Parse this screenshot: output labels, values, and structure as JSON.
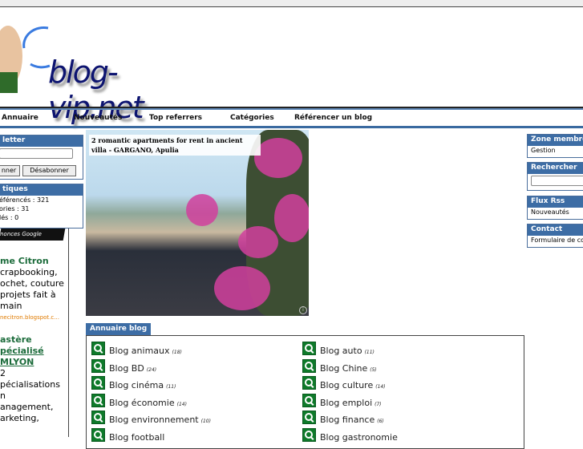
{
  "header": {
    "logo_text": "blog-vip.net"
  },
  "nav": [
    "Annuaire",
    "Nouveautés",
    "Top referrers",
    "Catégories",
    "Référencer un blog"
  ],
  "newsletter": {
    "title": "letter",
    "subscribe": "nner",
    "unsubscribe": "Désabonner"
  },
  "stats": {
    "title": "tiques",
    "rows": [
      "éférencés : 321",
      "ories : 31",
      "lés : 0"
    ]
  },
  "ads": {
    "label": "nonces Google",
    "items": [
      {
        "title": "me Citron",
        "lines": [
          "crapbooking,",
          "ochet, couture",
          " projets fait à",
          " main"
        ],
        "url": "necitron.blogspot.c..."
      },
      {
        "title": "astère",
        "title2": "pécialisé",
        "title3": "MLYON",
        "lines": [
          "2",
          "pécialisations",
          "n",
          "anagement,",
          "arketing,"
        ]
      }
    ]
  },
  "photo_ad": {
    "caption": "2 romantic apartments for rent in ancient villa - GARGANO, Apulia"
  },
  "right": {
    "zone": {
      "title": "Zone membre",
      "item": "Gestion"
    },
    "search": {
      "title": "Rechercher"
    },
    "rss": {
      "title": "Flux Rss",
      "item": "Nouveautés"
    },
    "contact": {
      "title": "Contact",
      "item": "Formulaire de co"
    }
  },
  "directory": {
    "title": "Annuaire blog",
    "items": [
      {
        "label": "Blog animaux",
        "count": "(18)"
      },
      {
        "label": "Blog auto",
        "count": "(11)"
      },
      {
        "label": "Blog BD",
        "count": "(24)"
      },
      {
        "label": "Blog Chine",
        "count": "(5)"
      },
      {
        "label": "Blog cinéma",
        "count": "(11)"
      },
      {
        "label": "Blog culture",
        "count": "(14)"
      },
      {
        "label": "Blog économie",
        "count": "(14)"
      },
      {
        "label": "Blog emploi",
        "count": "(7)"
      },
      {
        "label": "Blog environnement",
        "count": "(10)"
      },
      {
        "label": "Blog finance",
        "count": "(6)"
      },
      {
        "label": "Blog football",
        "count": ""
      },
      {
        "label": "Blog gastronomie",
        "count": ""
      }
    ]
  },
  "colors": {
    "accent": "#3d6da5",
    "icon": "#0e7a2a",
    "logo": "#0d1470"
  }
}
